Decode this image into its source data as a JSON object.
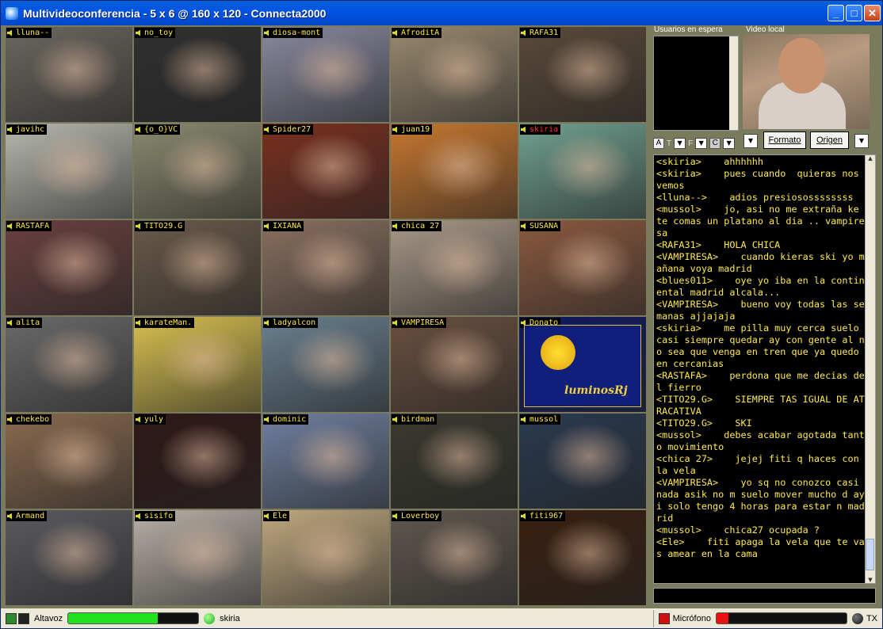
{
  "window": {
    "title": "Multivideoconferencia - 5 x 6 @ 160 x 120 - Connecta2000"
  },
  "grid": {
    "cols": 5,
    "tiles": [
      {
        "name": "lluna--",
        "color": "#6b6760"
      },
      {
        "name": "no_toy",
        "color": "#303030"
      },
      {
        "name": "diosa-mont",
        "color": "#8a8aa0"
      },
      {
        "name": "AfroditA",
        "color": "#9a8a70"
      },
      {
        "name": "RAFA31",
        "color": "#5a4a3a"
      },
      {
        "name": "javihc",
        "color": "#b8b8b0"
      },
      {
        "name": "{o_O}VC",
        "color": "#8a8a70"
      },
      {
        "name": "Spider27",
        "color": "#7a3020"
      },
      {
        "name": "juan19",
        "color": "#c87830"
      },
      {
        "name": "skiria",
        "color": "#70a090",
        "red": true
      },
      {
        "name": "RASTAFA",
        "color": "#6a4040"
      },
      {
        "name": "TITO29.G",
        "color": "#6a5a4a"
      },
      {
        "name": "IXIANA",
        "color": "#8a7060"
      },
      {
        "name": "chica 27",
        "color": "#a89888"
      },
      {
        "name": "SUSANA",
        "color": "#8a5a40"
      },
      {
        "name": "alita",
        "color": "#6a6a6a"
      },
      {
        "name": "karateMan.",
        "color": "#d8c050"
      },
      {
        "name": "ladyalcon",
        "color": "#6a8090"
      },
      {
        "name": "VAMPIRESA",
        "color": "#6a5040"
      },
      {
        "name": "Donato",
        "color": "#101a60"
      },
      {
        "name": "chekebo",
        "color": "#8a6a50"
      },
      {
        "name": "yuly",
        "color": "#301818"
      },
      {
        "name": "dominic",
        "color": "#7080a0"
      },
      {
        "name": "birdman",
        "color": "#3a3a30"
      },
      {
        "name": "mussol",
        "color": "#2a3a50"
      },
      {
        "name": "Armand",
        "color": "#5a5a60"
      },
      {
        "name": "sisifo",
        "color": "#b8b0a8"
      },
      {
        "name": "Ele",
        "color": "#c0a880"
      },
      {
        "name": "Loverboy",
        "color": "#605850"
      },
      {
        "name": "fiti967",
        "color": "#3a2010"
      }
    ],
    "donato_text": "luminosRj"
  },
  "panel": {
    "waiting_label": "Usuarios en espera",
    "local_label": "Video local",
    "controls": {
      "a": "A",
      "t": "T",
      "f": "F",
      "c": "C"
    },
    "format_button": "Formato",
    "source_button": "Origen"
  },
  "chat": {
    "messages": [
      "<skiria>    ahhhhhh",
      "<skiria>    pues cuando  quieras nos vemos",
      "<lluna-->    adios presiosossssssss",
      "<mussol>    jo, asi no me extraña ke te comas un platano al dia .. vampiresa",
      "<RAFA31>    HOLA CHICA",
      "<VAMPIRESA>    cuando kieras ski yo mañana voya madrid",
      "<blues011>    oye yo iba en la continental madrid alcala...",
      "<VAMPIRESA>    bueno voy todas las semanas ajjajaja",
      "<skiria>    me pilla muy cerca suelo  casi siempre quedar ay con gente al no sea que venga en tren que ya quedo  en cercanias",
      "<RASTAFA>    perdona que me decias del fierro",
      "<TITO29.G>    SIEMPRE TAS IGUAL DE ATRACATIVA",
      "<TITO29.G>    SKI",
      "<mussol>    debes acabar agotada tanto movimiento",
      "<chica 27>    jejej fiti q haces con la vela",
      "<VAMPIRESA>    yo sq no conozco casi nada asik no m suelo mover mucho d ayi solo tengo 4 horas para estar n madrid",
      "<mussol>    chica27 ocupada ?",
      "<Ele>    fiti apaga la vela que te vas amear en la cama"
    ]
  },
  "status": {
    "speaker_label": "Altavoz",
    "speaker_level": 0.69,
    "user": "skiria",
    "mic_label": "Micrófono",
    "mic_level": 0.09,
    "tx_label": "TX"
  }
}
